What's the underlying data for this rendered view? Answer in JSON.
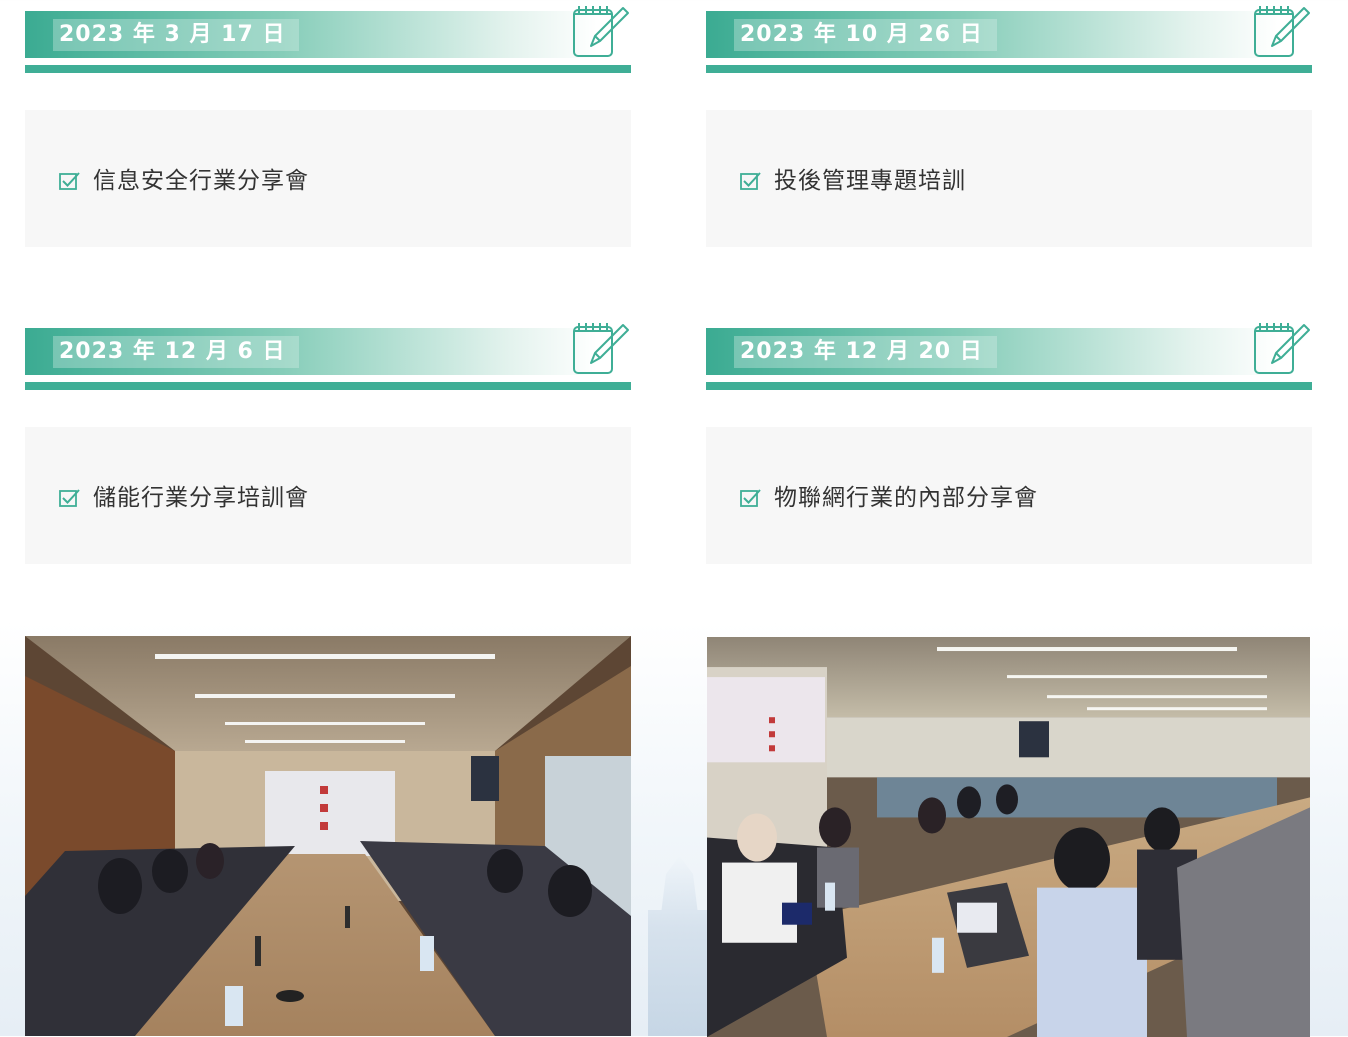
{
  "events": [
    {
      "date": "2023 年 3 月 17 日",
      "title": "信息安全行業分享會"
    },
    {
      "date": "2023 年 10 月 26 日",
      "title": "投後管理專題培訓"
    },
    {
      "date": "2023 年 12 月 6 日",
      "title": "儲能行業分享培訓會"
    },
    {
      "date": "2023 年 12 月 20 日",
      "title": "物聯網行業的內部分享會"
    }
  ],
  "icons": {
    "header": "notepad-pencil-icon",
    "item": "checkbox-check-icon"
  },
  "colors": {
    "accent": "#3fae96",
    "accent_light": "#86cdb9",
    "box_bg": "#f7f7f7",
    "text": "#333333"
  },
  "photos": [
    {
      "name": "meeting-photo-left"
    },
    {
      "name": "meeting-photo-right"
    }
  ]
}
